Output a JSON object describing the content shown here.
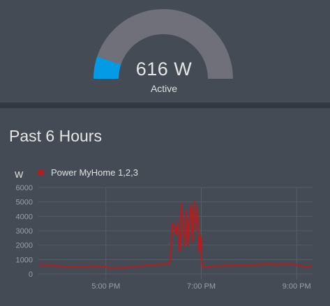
{
  "gauge": {
    "value_text": "616 W",
    "state_label": "Active",
    "value": 616,
    "min": 0,
    "max": 6000,
    "fill_color": "#039be5",
    "track_color": "#6f7079"
  },
  "history": {
    "title": "Past 6 Hours"
  },
  "chart_data": {
    "type": "line",
    "title": "",
    "ylabel": "W",
    "xlabel": "",
    "ylim": [
      0,
      6000
    ],
    "y_ticks": [
      "0",
      "1000",
      "2000",
      "3000",
      "4000",
      "5000",
      "6000"
    ],
    "x_ticks": [
      "5:00 PM",
      "7:00 PM",
      "9:00 PM"
    ],
    "grid": true,
    "legend_position": "top-left",
    "series": [
      {
        "name": "Power MyHome 1,2,3",
        "color": "#b71c1c",
        "x": [
          "15:35",
          "15:45",
          "15:55",
          "16:05",
          "16:15",
          "16:25",
          "16:35",
          "16:45",
          "16:55",
          "17:05",
          "17:15",
          "17:25",
          "17:35",
          "17:45",
          "17:55",
          "18:05",
          "18:15",
          "18:20",
          "18:22",
          "18:23",
          "18:26",
          "18:28",
          "18:30",
          "18:33",
          "18:35",
          "18:37",
          "18:39",
          "18:41",
          "18:43",
          "18:45",
          "18:47",
          "18:49",
          "18:51",
          "18:53",
          "18:55",
          "18:57",
          "18:59",
          "19:01",
          "19:03",
          "19:05",
          "19:07",
          "19:15",
          "19:25",
          "19:35",
          "19:45",
          "19:55",
          "20:05",
          "20:15",
          "20:25",
          "20:35",
          "20:45",
          "20:55",
          "21:05",
          "21:15",
          "21:20"
        ],
        "y": [
          650,
          620,
          560,
          540,
          510,
          500,
          530,
          560,
          520,
          450,
          440,
          460,
          480,
          560,
          600,
          650,
          700,
          750,
          1500,
          3500,
          3300,
          2700,
          3600,
          1500,
          4900,
          3500,
          1900,
          4400,
          1900,
          3800,
          4800,
          2200,
          5100,
          3000,
          4700,
          1500,
          2700,
          600,
          450,
          500,
          520,
          550,
          560,
          580,
          590,
          610,
          640,
          660,
          700,
          650,
          700,
          690,
          550,
          520,
          600
        ]
      }
    ]
  }
}
